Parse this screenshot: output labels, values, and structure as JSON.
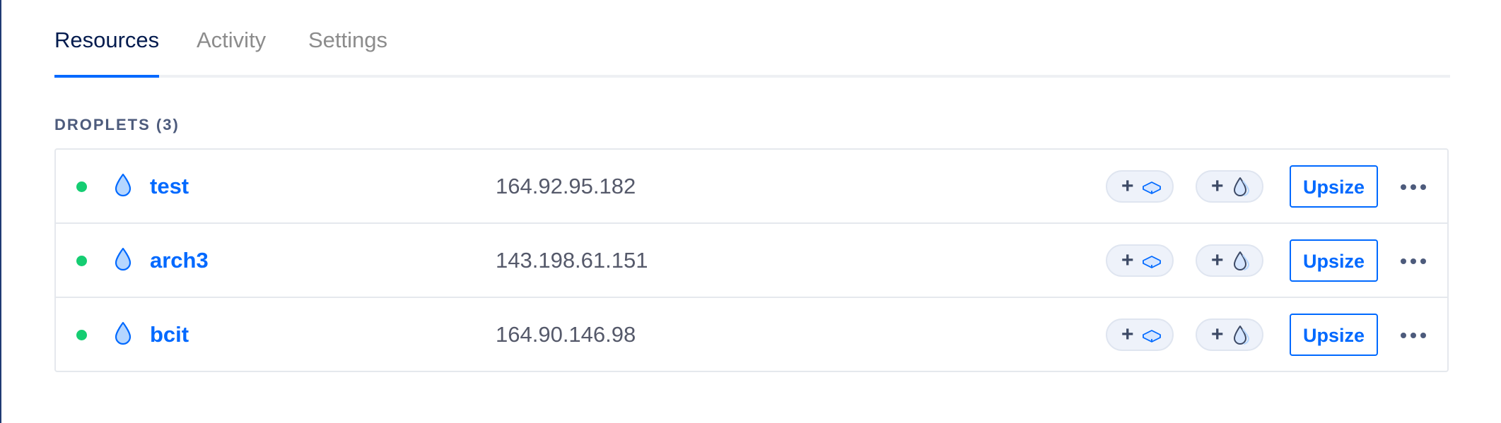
{
  "tabs": [
    {
      "label": "Resources",
      "active": true
    },
    {
      "label": "Activity",
      "active": false
    },
    {
      "label": "Settings",
      "active": false
    }
  ],
  "section": {
    "title": "DROPLETS",
    "count": "(3)"
  },
  "droplets": [
    {
      "status": "running",
      "name": "test",
      "ip": "164.92.95.182",
      "upsize_label": "Upsize",
      "add_volume_plus": "+",
      "add_droplet_plus": "+"
    },
    {
      "status": "running",
      "name": "arch3",
      "ip": "143.198.61.151",
      "upsize_label": "Upsize",
      "add_volume_plus": "+",
      "add_droplet_plus": "+"
    },
    {
      "status": "running",
      "name": "bcit",
      "ip": "164.90.146.98",
      "upsize_label": "Upsize",
      "add_volume_plus": "+",
      "add_droplet_plus": "+"
    }
  ],
  "icons": {
    "droplet": "droplet-icon",
    "volume": "volume-icon",
    "status": "status-dot",
    "more": "ellipsis-icon"
  },
  "colors": {
    "accent": "#0069ff",
    "status_running": "#15cd72",
    "text_primary": "#031b4e",
    "text_muted": "#8c8c8c"
  }
}
